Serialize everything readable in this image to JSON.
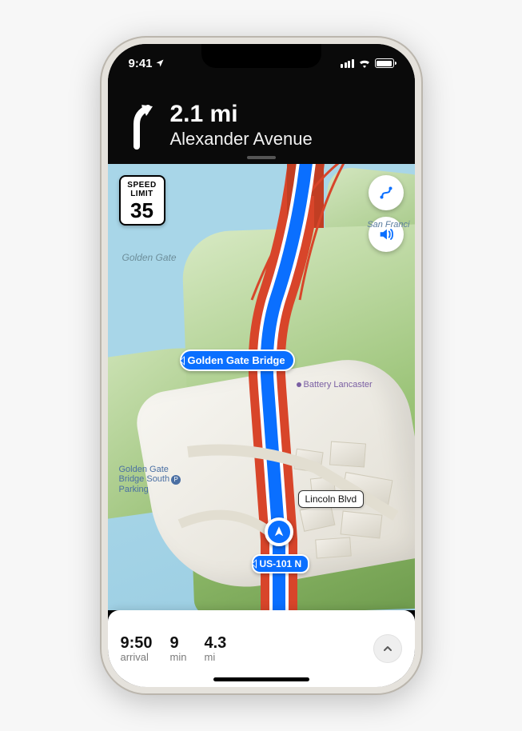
{
  "status": {
    "time": "9:41"
  },
  "navigation": {
    "distance": "2.1 mi",
    "street": "Alexander Avenue"
  },
  "speed_limit": {
    "line1": "SPEED",
    "line2": "LIMIT",
    "value": "35"
  },
  "map_labels": {
    "water": "Golden Gate",
    "park_ne": "San Franci",
    "poi_battery": "Battery Lancaster",
    "poi_parking_l1": "Golden Gate",
    "poi_parking_l2": "Bridge South",
    "poi_parking_l3": "Parking",
    "parking_badge": "P",
    "bridge_name": "Golden Gate Bridge",
    "street_lincoln": "Lincoln Blvd",
    "route_shield": "US-101 N"
  },
  "eta": {
    "arrival_value": "9:50",
    "arrival_label": "arrival",
    "minutes_value": "9",
    "minutes_label": "min",
    "dist_value": "4.3",
    "dist_label": "mi"
  }
}
